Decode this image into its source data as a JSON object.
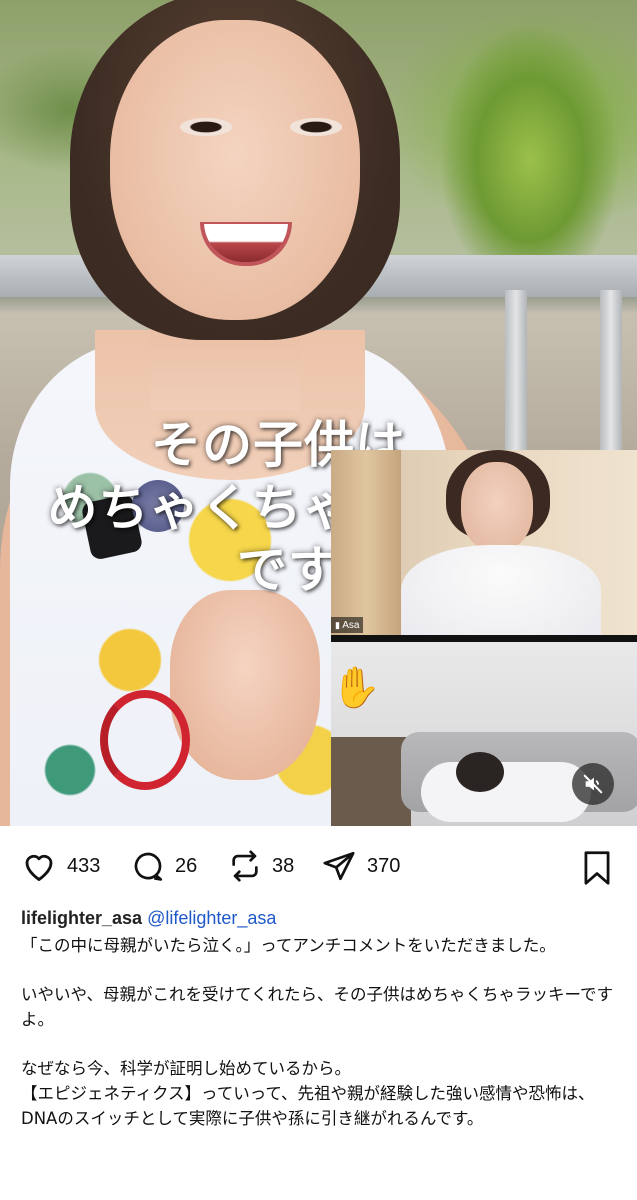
{
  "video": {
    "caption_lines": [
      "その子供は",
      "めちゃくちゃラッキー",
      "ですよ"
    ],
    "inset_name_tag": "Asa",
    "mute_icon": "speaker-muted-icon",
    "hand_icon": "raised-hand-icon"
  },
  "actions": {
    "like_count": "433",
    "comment_count": "26",
    "repost_count": "38",
    "share_count": "370"
  },
  "post": {
    "username": "lifelighter_asa",
    "mention": "@lifelighter_asa",
    "paragraph1": "「この中に母親がいたら泣く。」ってアンチコメントをいただきました。",
    "paragraph2": "いやいや、母親がこれを受けてくれたら、その子供はめちゃくちゃラッキーですよ。",
    "paragraph3_line1": "なぜなら今、科学が証明し始めているから。",
    "paragraph3_line2": "【エピジェネティクス】っていって、先祖や親が経験した強い感情や恐怖は、DNAのスイッチとして実際に子供や孫に引き継がれるんです。"
  }
}
